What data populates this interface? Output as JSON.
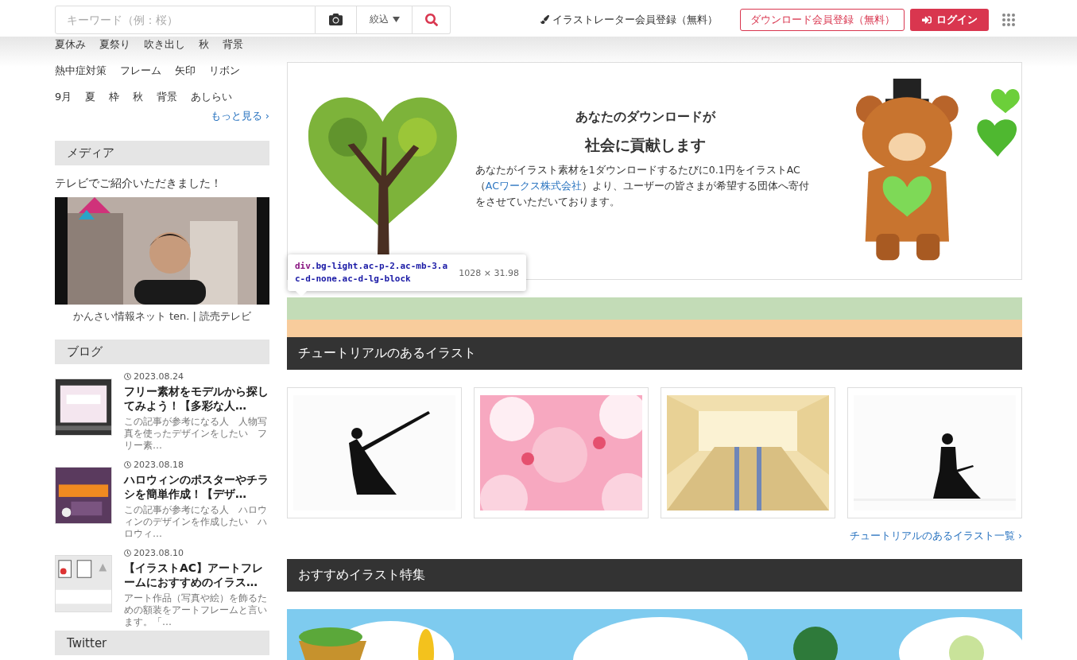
{
  "header": {
    "search": {
      "placeholder": "キーワード（例：桜）"
    },
    "filter": {
      "label": "絞込"
    },
    "illustrator_link": "イラストレーター会員登録（無料）",
    "register_button": "ダウンロード会員登録（無料）",
    "login_button": "ログイン"
  },
  "tags": [
    [
      "夏休み",
      "夏祭り",
      "吹き出し",
      "秋",
      "背景"
    ],
    [
      "熱中症対策",
      "フレーム",
      "矢印",
      "リボン"
    ],
    [
      "9月",
      "夏",
      "枠",
      "秋",
      "背景",
      "あしらい"
    ]
  ],
  "more_tags_link": "もっと見る ›",
  "media": {
    "title": "メディア",
    "intro": "テレビでご紹介いただきました！",
    "source": "かんさい情報ネット ten. | 読売テレビ"
  },
  "blog": {
    "title": "ブログ",
    "posts": [
      {
        "date": "2023.08.24",
        "title": "フリー素材をモデルから探してみよう！【多彩な人…",
        "excerpt": "この記事が参考になる人　人物写真を使ったデザインをしたい　フリー素…"
      },
      {
        "date": "2023.08.18",
        "title": "ハロウィンのポスターやチラシを簡単作成！【デザ…",
        "excerpt": "この記事が参考になる人　ハロウィンのデザインを作成したい　ハロウィ…"
      },
      {
        "date": "2023.08.10",
        "title": "【イラストAC】アートフレームにおすすめのイラス…",
        "excerpt": "アート作品（写真や絵）を飾るための額装をアートフレームと言います。「…"
      }
    ]
  },
  "twitter": {
    "title": "Twitter"
  },
  "banner": {
    "heading": "あなたのダウンロードが",
    "subheading": "社会に貢献します",
    "body_before": "あなたがイラスト素材を1ダウンロードするたびに0.1円をイラストAC（",
    "body_link": "ACワークス株式会社",
    "body_after": "）より、ユーザーの皆さまが希望する団体へ寄付をさせていただいております。"
  },
  "devtools_tooltip": {
    "tag": "div",
    "classes": ".bg-light.ac-p-2.ac-mb-3.ac-d-none.ac-d-lg-block",
    "size": "1028 × 31.98"
  },
  "tutorials": {
    "title": "チュートリアルのあるイラスト",
    "items": [
      {
        "kind": "samurai"
      },
      {
        "kind": "hearts"
      },
      {
        "kind": "hall"
      },
      {
        "kind": "kneeling"
      }
    ],
    "more_link": "チュートリアルのあるイラスト一覧 ›"
  },
  "featured": {
    "title": "おすすめイラスト特集"
  }
}
